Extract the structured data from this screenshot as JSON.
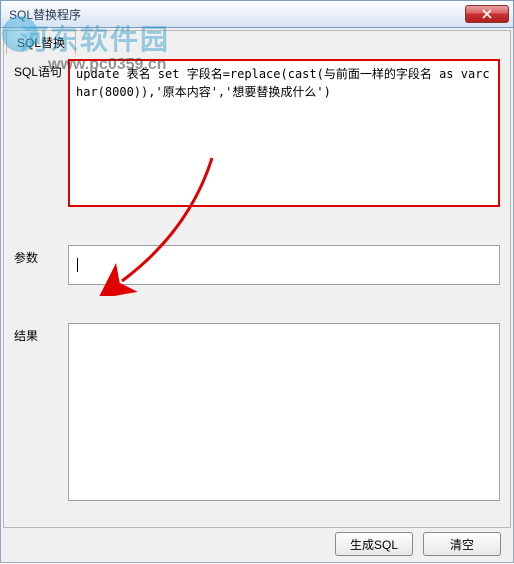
{
  "window": {
    "title": "SQL替换程序"
  },
  "watermark": {
    "cn": "河东软件园",
    "url": "www.pc0359.cn"
  },
  "tab": {
    "label": "SQL替换"
  },
  "labels": {
    "sql": "SQL语句",
    "param": "参数",
    "result": "结果"
  },
  "sql": {
    "text": "update 表名 set 字段名=replace(cast(与前面一样的字段名 as varchar(8000)),'原本内容','想要替换成什么')"
  },
  "param": {
    "value": ""
  },
  "result": {
    "value": ""
  },
  "buttons": {
    "generate": "生成SQL",
    "clear": "清空"
  }
}
